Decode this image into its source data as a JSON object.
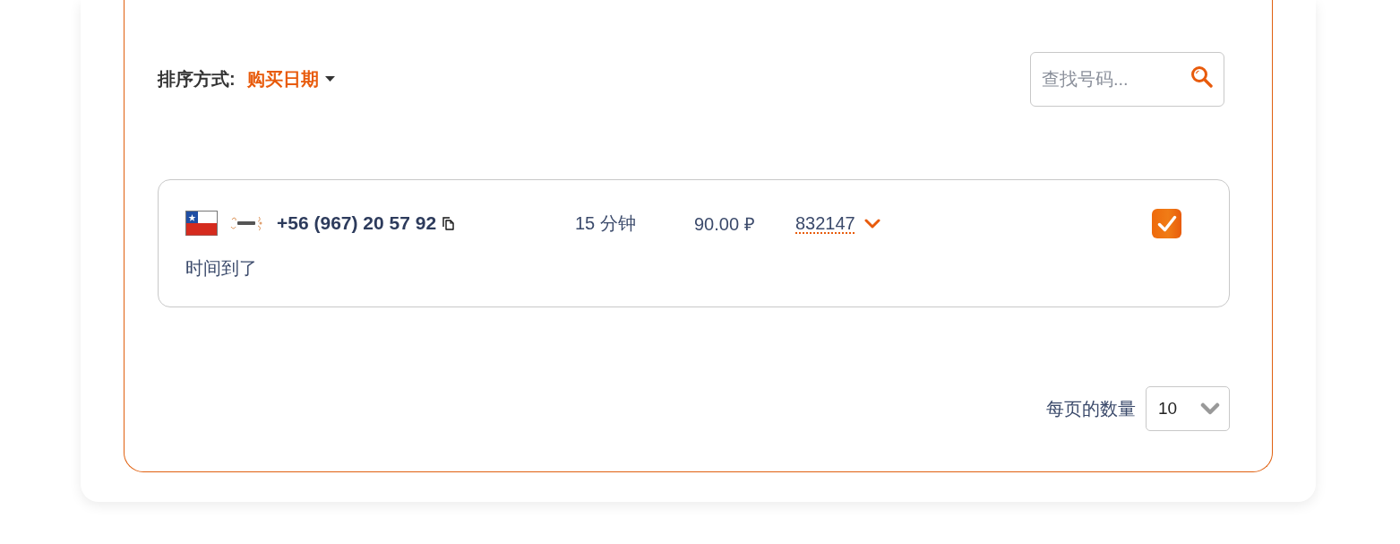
{
  "sort": {
    "label": "排序方式:",
    "value": "购买日期"
  },
  "search": {
    "placeholder": "查找号码..."
  },
  "orders": [
    {
      "phone": "+56 (967) 20 57 92",
      "duration": "15 分钟",
      "price": "90.00 ₽",
      "code": "832147",
      "checked": true,
      "status": "时间到了"
    }
  ],
  "pagination": {
    "label": "每页的数量",
    "per_page": "10"
  }
}
